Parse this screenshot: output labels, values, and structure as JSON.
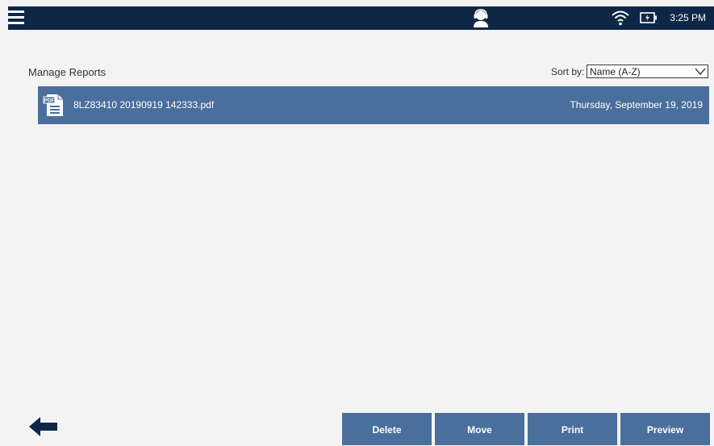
{
  "status_bar": {
    "time": "3:25 PM",
    "icons": [
      "menu-icon",
      "support-agent-icon",
      "wifi-icon",
      "battery-icon"
    ]
  },
  "page": {
    "title": "Manage Reports"
  },
  "sort": {
    "label": "Sort by:",
    "selected": "Name (A-Z)"
  },
  "reports": [
    {
      "file_name": "8LZ83410 20190919 142333.pdf",
      "date": "Thursday, September 19, 2019",
      "icon": "pdf-file-icon",
      "icon_text": "PDF"
    }
  ],
  "actions": {
    "delete": "Delete",
    "move": "Move",
    "print": "Print",
    "preview": "Preview"
  },
  "colors": {
    "topbar": "#0f2747",
    "accent": "#4a6f9c",
    "background": "#f3f3f3"
  }
}
